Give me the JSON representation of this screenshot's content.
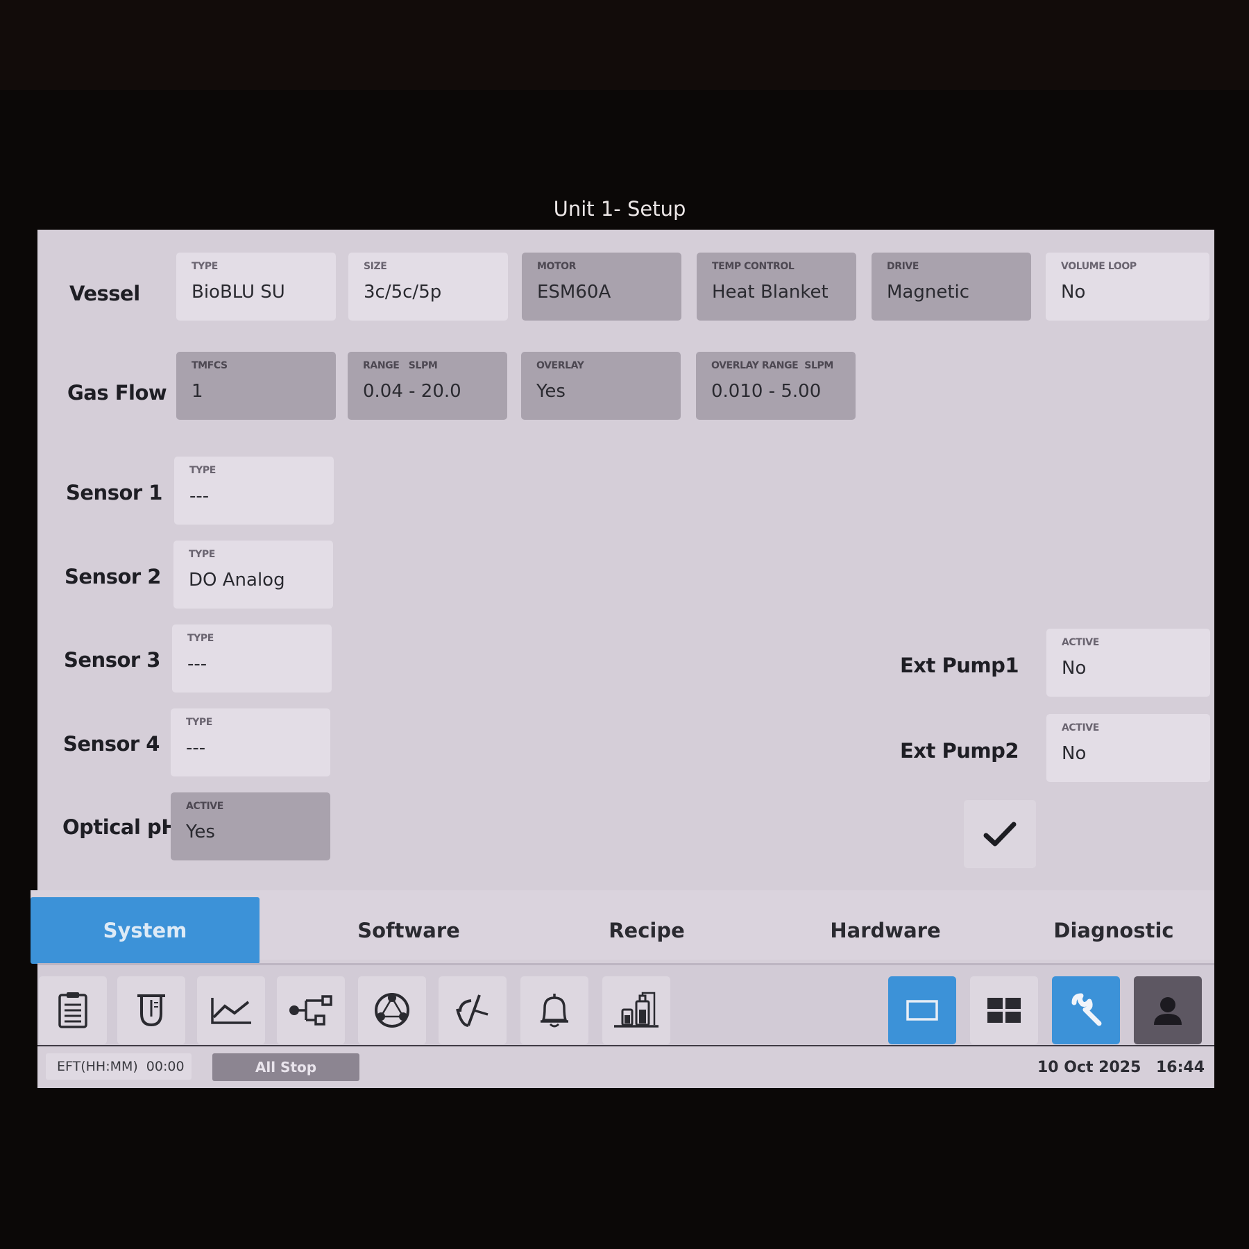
{
  "title": "Unit 1- Setup",
  "vessel": {
    "label": "Vessel",
    "fields": [
      {
        "cap": "TYPE",
        "val": "BioBLU SU"
      },
      {
        "cap": "SIZE",
        "val": "3c/5c/5p"
      },
      {
        "cap": "MOTOR",
        "val": "ESM60A"
      },
      {
        "cap": "TEMP CONTROL",
        "val": "Heat Blanket"
      },
      {
        "cap": "DRIVE",
        "val": "Magnetic"
      },
      {
        "cap": "VOLUME LOOP",
        "val": "No"
      }
    ]
  },
  "gas_flow": {
    "label": "Gas Flow",
    "fields": [
      {
        "cap": "TMFCS",
        "val": "1"
      },
      {
        "cap": "RANGE   SLPM",
        "val": "0.04 - 20.0"
      },
      {
        "cap": "OVERLAY",
        "val": "Yes"
      },
      {
        "cap": "OVERLAY RANGE  SLPM",
        "val": "0.010 - 5.00"
      }
    ]
  },
  "sensors": [
    {
      "label": "Sensor 1",
      "cap": "TYPE",
      "val": "---"
    },
    {
      "label": "Sensor 2",
      "cap": "TYPE",
      "val": "DO Analog"
    },
    {
      "label": "Sensor 3",
      "cap": "TYPE",
      "val": "---"
    },
    {
      "label": "Sensor 4",
      "cap": "TYPE",
      "val": "---"
    }
  ],
  "optical_ph": {
    "label": "Optical pH",
    "cap": "ACTIVE",
    "val": "Yes"
  },
  "ext_pumps": [
    {
      "label": "Ext Pump1",
      "cap": "ACTIVE",
      "val": "No"
    },
    {
      "label": "Ext Pump2",
      "cap": "ACTIVE",
      "val": "No"
    }
  ],
  "tabs": [
    {
      "label": "System",
      "active": true
    },
    {
      "label": "Software"
    },
    {
      "label": "Recipe"
    },
    {
      "label": "Hardware"
    },
    {
      "label": "Diagnostic"
    }
  ],
  "toolbar_icons": [
    "clipboard-icon",
    "vessel-icon",
    "trend-chart-icon",
    "flow-diagram-icon",
    "pump-icon",
    "gauge-needle-icon",
    "bell-icon",
    "feed-bottles-icon",
    "single-view-icon",
    "grid-view-icon",
    "wrench-icon",
    "user-icon"
  ],
  "status": {
    "eft_label": "EFT(HH:MM)",
    "eft_value": "00:00",
    "all_stop": "All Stop",
    "date": "10 Oct 2025",
    "time": "16:44"
  },
  "colors": {
    "accent": "#3c92d8",
    "panel": "#d5ced8",
    "field_light": "#e3dde6",
    "field_dark": "#a9a2ad"
  }
}
